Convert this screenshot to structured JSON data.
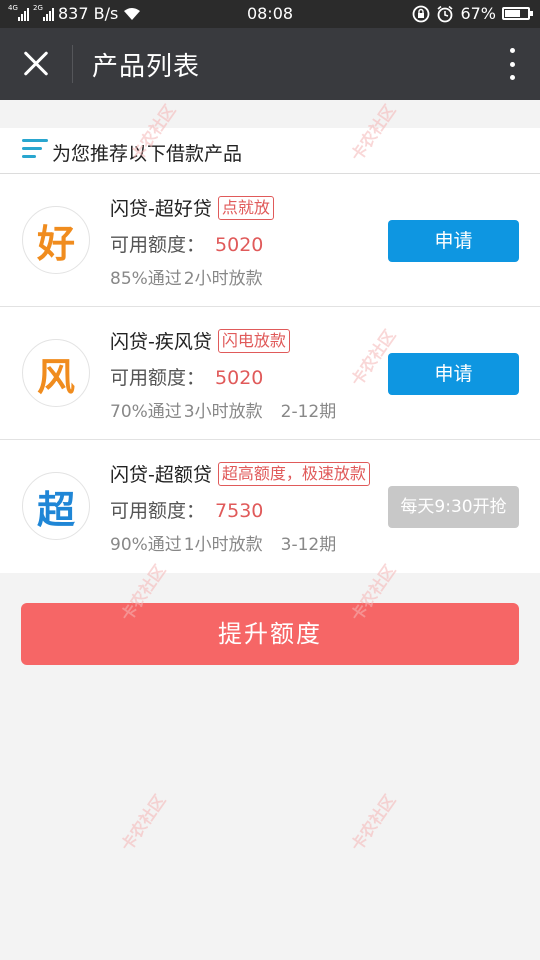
{
  "status_bar": {
    "net_speed": "837 B/s",
    "time": "08:08",
    "battery": "67%",
    "battery_level": 0.67,
    "sim1_tag": "4G",
    "sim2_tag": "2G"
  },
  "header": {
    "title": "产品列表"
  },
  "section": {
    "title": "为您推荐以下借款产品"
  },
  "products": [
    {
      "logo_char": "好",
      "logo_color": "#f08c1e",
      "name": "闪贷-超好贷",
      "tag": "点就放",
      "quota_label": "可用额度：",
      "quota": "5020",
      "pass_rate": "85%通过",
      "loan_time": "2小时放款",
      "term": "",
      "button": "申请",
      "button_enabled": true
    },
    {
      "logo_char": "风",
      "logo_color": "#f08c1e",
      "name": "闪贷-疾风贷",
      "tag": "闪电放款",
      "quota_label": "可用额度：",
      "quota": "5020",
      "pass_rate": "70%通过",
      "loan_time": "3小时放款",
      "term": "2-12期",
      "button": "申请",
      "button_enabled": true
    },
    {
      "logo_char": "超",
      "logo_color": "#1f86d6",
      "name": "闪贷-超额贷",
      "tag": "超高额度，极速放款",
      "quota_label": "可用额度：",
      "quota": "7530",
      "pass_rate": "90%通过",
      "loan_time": "1小时放款",
      "term": "3-12期",
      "button": "每天9:30开抢",
      "button_enabled": false
    }
  ],
  "actions": {
    "raise_quota": "提升额度"
  },
  "watermark": "卡农社区",
  "colors": {
    "accent_blue": "#0e96e1",
    "accent_red": "#e05a5a",
    "raise_button": "#f66666",
    "title_bar": "#393a3e"
  }
}
